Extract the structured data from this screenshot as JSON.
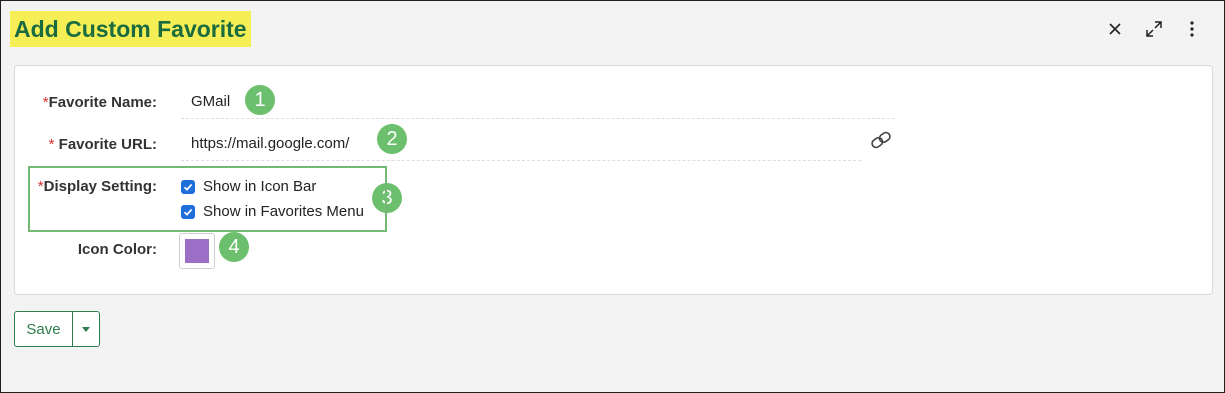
{
  "dialog": {
    "title": "Add Custom Favorite"
  },
  "window_controls": {
    "close_icon": "close-icon",
    "expand_icon": "expand-icon",
    "more_icon": "more-vertical-icon"
  },
  "form": {
    "favorite_name": {
      "required_mark": "*",
      "label": "Favorite Name:",
      "value": "GMail",
      "step": "1"
    },
    "favorite_url": {
      "required_mark": "*",
      "label": " Favorite URL:",
      "value": "https://mail.google.com/",
      "step": "2",
      "link_icon": "link-icon"
    },
    "display_setting": {
      "required_mark": "*",
      "label": "Display Setting:",
      "step": "3",
      "options": [
        {
          "label": "Show in Icon Bar",
          "checked": true
        },
        {
          "label": "Show in Favorites Menu",
          "checked": true
        }
      ]
    },
    "icon_color": {
      "label": "Icon Color:",
      "color": "#9b6fc6",
      "step": "4"
    }
  },
  "footer": {
    "save_label": "Save",
    "dropdown_icon": "caret-down-icon"
  },
  "colors": {
    "title_highlight": "#f5ef55",
    "title_text": "#1a6b3f",
    "badge": "#6bbf6d",
    "checkbox": "#1e6fd9",
    "save_border": "#2e7d4f"
  }
}
